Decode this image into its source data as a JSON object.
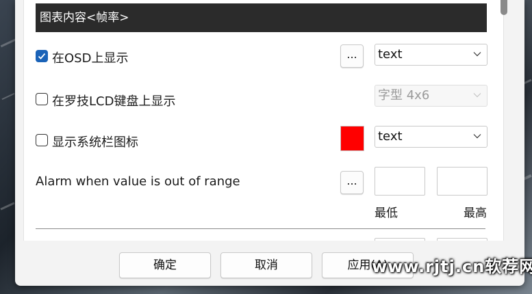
{
  "header": {
    "title": "图表内容<帧率>"
  },
  "osd": {
    "label": "在OSD上显示",
    "checked": true,
    "dots": "...",
    "select_value": "text"
  },
  "lcd": {
    "label": "在罗技LCD键盘上显示",
    "checked": false,
    "select_value": "字型 4x6"
  },
  "tray": {
    "label": "显示系统栏图标",
    "checked": false,
    "color": "#ff0000",
    "select_value": "text"
  },
  "alarm": {
    "label": "Alarm when value is out of range",
    "dots": "...",
    "min_label": "最低",
    "max_label": "最高",
    "min_value": "",
    "max_value": ""
  },
  "buttons": {
    "ok": "确定",
    "cancel": "取消",
    "apply": "应用(A)"
  },
  "watermark": "www.rjtj.cn软荐网"
}
